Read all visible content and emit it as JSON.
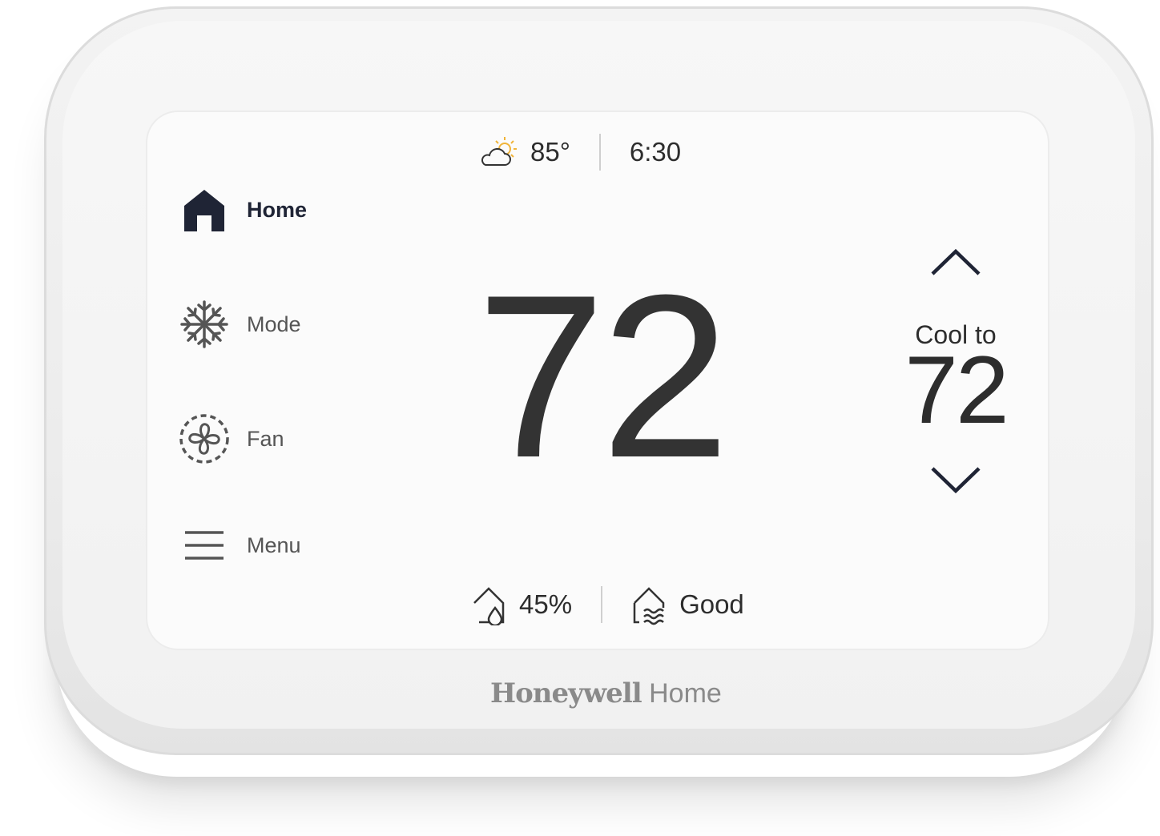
{
  "status_bar": {
    "weather_icon": "partly-cloudy-icon",
    "outdoor_temp": "85°",
    "time": "6:30"
  },
  "nav": {
    "items": [
      {
        "label": "Home",
        "icon": "home-icon",
        "active": true
      },
      {
        "label": "Mode",
        "icon": "snowflake-icon",
        "active": false
      },
      {
        "label": "Fan",
        "icon": "fan-icon",
        "active": false
      },
      {
        "label": "Menu",
        "icon": "hamburger-menu-icon",
        "active": false
      }
    ]
  },
  "main": {
    "current_temperature": "72"
  },
  "setpoint": {
    "label": "Cool to",
    "value": "72",
    "up_icon": "chevron-up-icon",
    "down_icon": "chevron-down-icon"
  },
  "bottom_bar": {
    "humidity_icon": "home-humidity-icon",
    "humidity": "45%",
    "air_quality_icon": "home-air-quality-icon",
    "air_quality": "Good"
  },
  "brand": {
    "primary": "Honeywell",
    "secondary": "Home"
  },
  "colors": {
    "active_nav": "#1f2435",
    "text": "#2d2d2d",
    "weather_sun": "#f0b43a"
  }
}
